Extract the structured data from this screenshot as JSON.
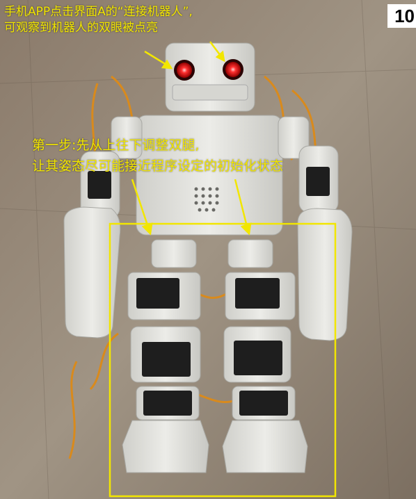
{
  "page_number": "10",
  "annotations": {
    "top_line1": "手机APP点击界面A的“连接机器人”,",
    "top_line2": "可观察到机器人的双眼被点亮",
    "step_line1": "第一步:先从上往下调整双腿,",
    "step_line2": "让其姿态尽可能接近程序设定的初始化状态"
  },
  "colors": {
    "annotation": "#f2e600",
    "highlight_box": "#f2e600",
    "robot_eye": "#ff2a2a",
    "robot_body": "#e6e6e2",
    "servo": "#1e1e1e",
    "wire": "#d98a1c"
  },
  "icons": [
    "arrow-icon",
    "highlight-box"
  ]
}
